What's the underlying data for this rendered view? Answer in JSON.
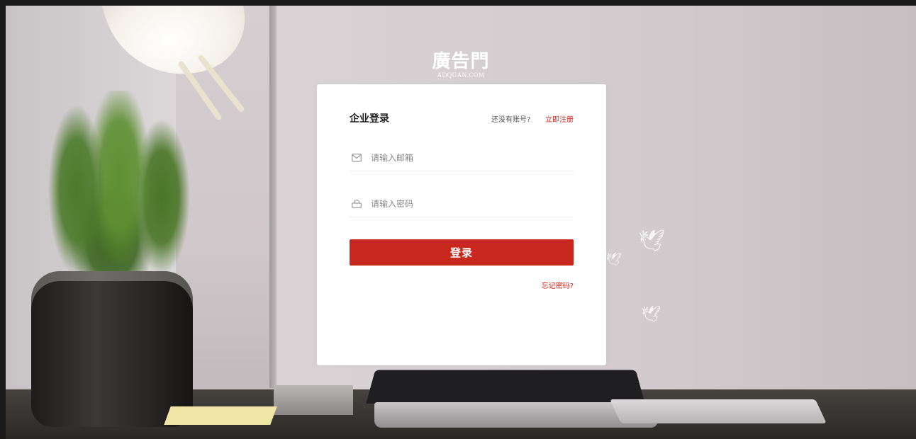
{
  "logo": {
    "mark": "廣告門",
    "sub": "ADQUAN.COM"
  },
  "login": {
    "title": "企业登录",
    "no_account_text": "还没有账号?",
    "register_label": "立即注册",
    "email": {
      "placeholder": "请输入邮箱",
      "value": "",
      "icon": "mail-icon"
    },
    "password": {
      "placeholder": "请输入密码",
      "value": "",
      "icon": "lock-icon"
    },
    "submit_label": "登录",
    "forgot_label": "忘记密码?"
  },
  "colors": {
    "accent": "#c8281e",
    "link": "#c8261d",
    "card": "#ffffff"
  }
}
